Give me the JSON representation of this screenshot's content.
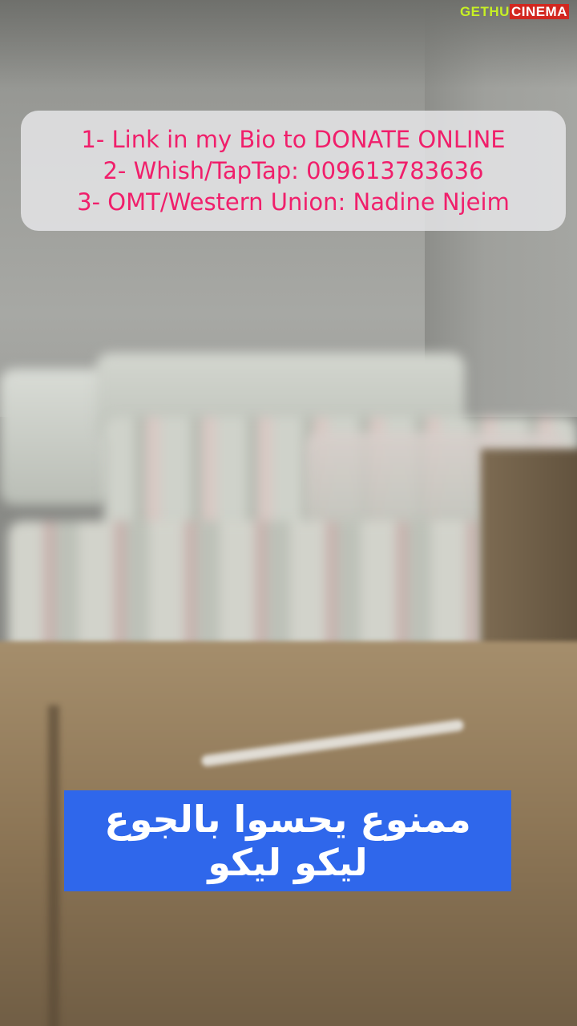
{
  "watermark": {
    "part1": "GETHU",
    "part2": "CINEMA"
  },
  "donation": {
    "lines": [
      "1- Link in my Bio to DONATE ONLINE",
      "2- Whish/TapTap: 009613783636",
      "3- OMT/Western Union: Nadine Njeim"
    ]
  },
  "caption": {
    "lines": [
      "ممنوع يحسوا بالجوع",
      "ليكو ليكو"
    ]
  },
  "colors": {
    "donation_text": "#f01f6b",
    "caption_background": "#2f67eb",
    "caption_text": "#ffffff"
  }
}
